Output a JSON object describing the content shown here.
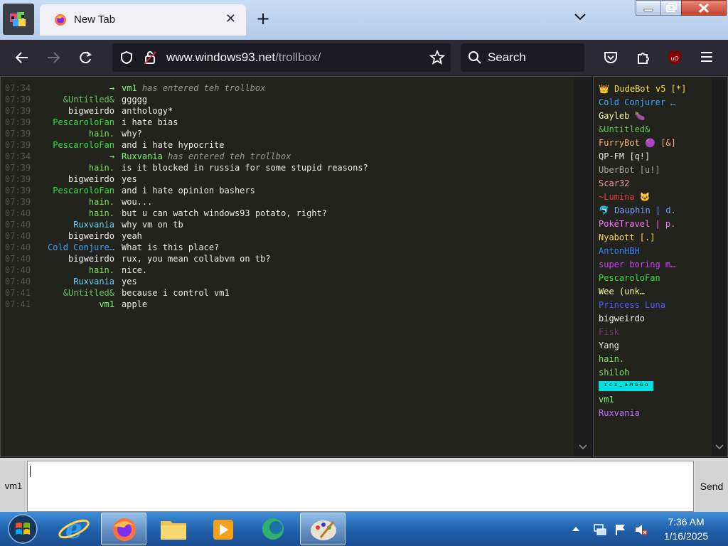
{
  "browser": {
    "tab_title": "New Tab",
    "url_domain": "www.windows93.net",
    "url_path": "/trollbox/",
    "search_placeholder": "Search"
  },
  "chat": {
    "messages": [
      {
        "time": "07:34",
        "nick": "→",
        "nick_color": "#7cfc6c",
        "text": "has entered teh trollbox",
        "system": true,
        "sys_nick": "vm1"
      },
      {
        "time": "07:39",
        "nick": "&Untitled&",
        "nick_color": "#63c65c",
        "text": "ggggg"
      },
      {
        "time": "07:39",
        "nick": "bigweirdo",
        "nick_color": "#f2f2f2",
        "text": "anthology*"
      },
      {
        "time": "07:39",
        "nick": "PescaroloFan",
        "nick_color": "#35e03a",
        "text": "i hate bias"
      },
      {
        "time": "07:39",
        "nick": "hain.",
        "nick_color": "#7ee05a",
        "text": "why?"
      },
      {
        "time": "07:39",
        "nick": "PescaroloFan",
        "nick_color": "#35e03a",
        "text": "and i hate hypocrite"
      },
      {
        "time": "07:34",
        "nick": "→",
        "nick_color": "#7cfc6c",
        "text": "has entered teh trollbox",
        "system": true,
        "sys_nick": "Ruxvania"
      },
      {
        "time": "07:39",
        "nick": "hain.",
        "nick_color": "#7ee05a",
        "text": "is it blocked in russia for some stupid reasons?"
      },
      {
        "time": "07:39",
        "nick": "bigweirdo",
        "nick_color": "#f2f2f2",
        "text": "yes"
      },
      {
        "time": "07:39",
        "nick": "PescaroloFan",
        "nick_color": "#35e03a",
        "text": "and i hate opinion bashers"
      },
      {
        "time": "07:39",
        "nick": "hain.",
        "nick_color": "#7ee05a",
        "text": "wou..."
      },
      {
        "time": "07:40",
        "nick": "hain.",
        "nick_color": "#7ee05a",
        "text": "but u can watch windows93 potato, right?"
      },
      {
        "time": "07:40",
        "nick": "Ruxvania",
        "nick_color": "#5cd6ff",
        "text": "why vm on tb"
      },
      {
        "time": "07:40",
        "nick": "bigweirdo",
        "nick_color": "#f2f2f2",
        "text": "yeah"
      },
      {
        "time": "07:40",
        "nick": "Cold Conjure…",
        "nick_color": "#3ea7ff",
        "text": "What is this place?"
      },
      {
        "time": "07:40",
        "nick": "bigweirdo",
        "nick_color": "#f2f2f2",
        "text": "rux, you mean collabvm on tb?"
      },
      {
        "time": "07:40",
        "nick": "hain.",
        "nick_color": "#7ee05a",
        "text": "nice."
      },
      {
        "time": "07:40",
        "nick": "Ruxvania",
        "nick_color": "#5cd6ff",
        "text": "yes"
      },
      {
        "time": "07:41",
        "nick": "&Untitled&",
        "nick_color": "#63c65c",
        "text": "because i control vm1"
      },
      {
        "time": "07:41",
        "nick": "vm1",
        "nick_color": "#7cfc6c",
        "text": "apple"
      }
    ]
  },
  "users": [
    {
      "name": "👑 DudeBot v5 [*]",
      "color": "#ffe14a"
    },
    {
      "name": "Cold Conjurer …",
      "color": "#3ea7ff"
    },
    {
      "name": "Gayleb 🍆",
      "color": "#ffffa0"
    },
    {
      "name": "&Untitled&",
      "color": "#63c65c"
    },
    {
      "name": "FurryBot 🟣 [&]",
      "color": "#ffb07a"
    },
    {
      "name": "QP-FM [q!]",
      "color": "#e8e8e8"
    },
    {
      "name": "UberBot [u!]",
      "color": "#a8a8a8"
    },
    {
      "name": "Scar32",
      "color": "#f0a0a0"
    },
    {
      "name": "~Lumina 🐱",
      "color": "#e83a3a"
    },
    {
      "name": "🐬 Dauphin | d.",
      "color": "#6da0ff"
    },
    {
      "name": "PokéTravel | p.",
      "color": "#ff70ff"
    },
    {
      "name": "Nyabott [.]",
      "color": "#ffd84a"
    },
    {
      "name": "AntonHBH",
      "color": "#3a7dff"
    },
    {
      "name": "super boring m…",
      "color": "#d040ff"
    },
    {
      "name": "PescaroloFan",
      "color": "#35e03a"
    },
    {
      "name": "Wee (unk…",
      "color": "#ffffa0"
    },
    {
      "name": "Princess Luna",
      "color": "#5a5aff"
    },
    {
      "name": "bigweirdo",
      "color": "#f2f2f2"
    },
    {
      "name": "Fisk",
      "color": "#6a3a6a"
    },
    {
      "name": "Yang",
      "color": "#e8e8e8"
    },
    {
      "name": "hain.",
      "color": "#7ee05a"
    },
    {
      "name": "shiloh",
      "color": "#7ee05a"
    },
    {
      "name": "ᶦᶜᶦ-ᵃᴹᴳᴳᵒ",
      "color": "#ffffff",
      "highlight": "#00e0e0"
    },
    {
      "name": "vm1",
      "color": "#7cfc6c"
    },
    {
      "name": "Ruxvania",
      "color": "#c070ff"
    }
  ],
  "input": {
    "nick_label": "vm1",
    "send_label": "Send"
  },
  "taskbar": {
    "time": "7:36 AM",
    "date": "1/16/2025"
  }
}
